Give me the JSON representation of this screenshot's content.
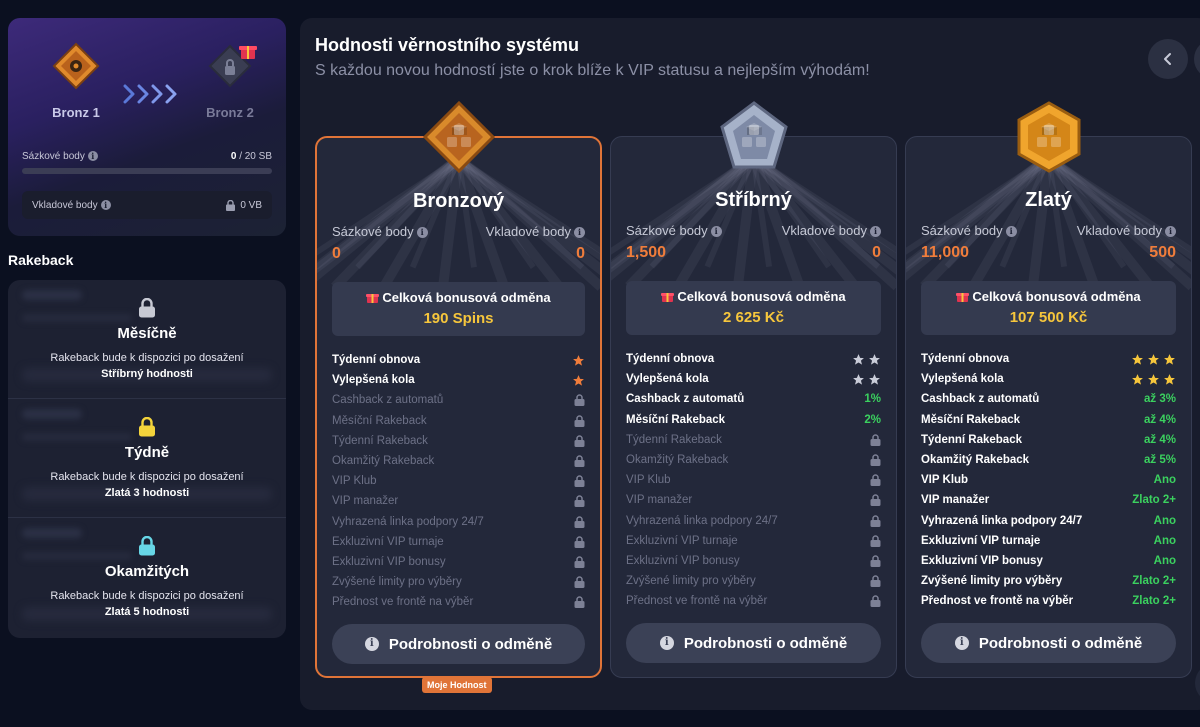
{
  "progress": {
    "from_rank": "Bronz 1",
    "to_rank": "Bronz 2",
    "betting_points_label": "Sázkové body",
    "betting_points_current": "0",
    "betting_points_target": "/ 20 SB",
    "betting_progress_fraction": 0,
    "deposit_points_label": "Vkladové body",
    "deposit_points_value": "0 VB"
  },
  "rakeback": {
    "title": "Rakeback",
    "sections": [
      {
        "name": "Měsíčně",
        "desc_pre": "Rakeback bude k dispozici po dosažení",
        "desc_bold": "Stříbrný hodnosti",
        "lock_color": "#c7c9d3"
      },
      {
        "name": "Týdně",
        "desc_pre": "Rakeback bude k dispozici po dosažení",
        "desc_bold": "Zlatá 3 hodnosti",
        "lock_color": "#f3d33b"
      },
      {
        "name": "Okamžitých",
        "desc_pre": "Rakeback bude k dispozici po dosažení",
        "desc_bold": "Zlatá 5 hodnosti",
        "lock_color": "#67d6e6"
      }
    ]
  },
  "main": {
    "title": "Hodnosti věrnostního systému",
    "subtitle": "S každou novou hodností jste o krok blíže k VIP statusu a nejlepším výhodám!",
    "back_icon": "chevron-left-icon",
    "betting_label": "Sázkové body",
    "deposit_label": "Vkladové body",
    "bonus_label": "Celková bonusová odměna",
    "details_label": "Podrobnosti o odměně",
    "current_badge": "Moje Hodnost",
    "tiers": [
      {
        "name": "Bronzový",
        "betting": "0",
        "deposit": "0",
        "bonus": "190 Spins",
        "color": "#d98a2b",
        "features": [
          {
            "label": "Týdenní obnova",
            "kind": "stars",
            "stars": 1,
            "star_color": "#f07d3b",
            "on": true
          },
          {
            "label": "Vylepšená kola",
            "kind": "stars",
            "stars": 1,
            "star_color": "#f07d3b",
            "on": true
          },
          {
            "label": "Cashback z automatů",
            "kind": "lock",
            "on": false
          },
          {
            "label": "Měsíční Rakeback",
            "kind": "lock",
            "on": false
          },
          {
            "label": "Týdenní Rakeback",
            "kind": "lock",
            "on": false
          },
          {
            "label": "Okamžitý Rakeback",
            "kind": "lock",
            "on": false
          },
          {
            "label": "VIP Klub",
            "kind": "lock",
            "on": false
          },
          {
            "label": "VIP manažer",
            "kind": "lock",
            "on": false
          },
          {
            "label": "Vyhrazená linka podpory 24/7",
            "kind": "lock",
            "on": false
          },
          {
            "label": "Exkluzivní VIP turnaje",
            "kind": "lock",
            "on": false
          },
          {
            "label": "Exkluzivní VIP bonusy",
            "kind": "lock",
            "on": false
          },
          {
            "label": "Zvýšené limity pro výběry",
            "kind": "lock",
            "on": false
          },
          {
            "label": "Přednost ve frontě na výběr",
            "kind": "lock",
            "on": false
          }
        ]
      },
      {
        "name": "Stříbrný",
        "betting": "1,500",
        "deposit": "0",
        "bonus": "2 625 Kč",
        "color": "#a6b2c9",
        "features": [
          {
            "label": "Týdenní obnova",
            "kind": "stars",
            "stars": 2,
            "star_color": "#c9ccd8",
            "on": true
          },
          {
            "label": "Vylepšená kola",
            "kind": "stars",
            "stars": 2,
            "star_color": "#c9ccd8",
            "on": true
          },
          {
            "label": "Cashback z automatů",
            "kind": "value",
            "value": "1%",
            "on": true
          },
          {
            "label": "Měsíční Rakeback",
            "kind": "value",
            "value": "2%",
            "on": true
          },
          {
            "label": "Týdenní Rakeback",
            "kind": "lock",
            "on": false
          },
          {
            "label": "Okamžitý Rakeback",
            "kind": "lock",
            "on": false
          },
          {
            "label": "VIP Klub",
            "kind": "lock",
            "on": false
          },
          {
            "label": "VIP manažer",
            "kind": "lock",
            "on": false
          },
          {
            "label": "Vyhrazená linka podpory 24/7",
            "kind": "lock",
            "on": false
          },
          {
            "label": "Exkluzivní VIP turnaje",
            "kind": "lock",
            "on": false
          },
          {
            "label": "Exkluzivní VIP bonusy",
            "kind": "lock",
            "on": false
          },
          {
            "label": "Zvýšené limity pro výběry",
            "kind": "lock",
            "on": false
          },
          {
            "label": "Přednost ve frontě na výběr",
            "kind": "lock",
            "on": false
          }
        ]
      },
      {
        "name": "Zlatý",
        "betting": "11,000",
        "deposit": "500",
        "bonus": "107 500 Kč",
        "color": "#f0a52d",
        "features": [
          {
            "label": "Týdenní obnova",
            "kind": "stars",
            "stars": 3,
            "star_color": "#f6c63c",
            "on": true
          },
          {
            "label": "Vylepšená kola",
            "kind": "stars",
            "stars": 3,
            "star_color": "#f6c63c",
            "on": true
          },
          {
            "label": "Cashback z automatů",
            "kind": "value",
            "value": "až 3%",
            "on": true
          },
          {
            "label": "Měsíční Rakeback",
            "kind": "value",
            "value": "až 4%",
            "on": true
          },
          {
            "label": "Týdenní Rakeback",
            "kind": "value",
            "value": "až 4%",
            "on": true
          },
          {
            "label": "Okamžitý Rakeback",
            "kind": "value",
            "value": "až 5%",
            "on": true
          },
          {
            "label": "VIP Klub",
            "kind": "value",
            "value": "Ano",
            "on": true
          },
          {
            "label": "VIP manažer",
            "kind": "value",
            "value": "Zlato 2+",
            "on": true
          },
          {
            "label": "Vyhrazená linka podpory 24/7",
            "kind": "value",
            "value": "Ano",
            "on": true
          },
          {
            "label": "Exkluzivní VIP turnaje",
            "kind": "value",
            "value": "Ano",
            "on": true
          },
          {
            "label": "Exkluzivní VIP bonusy",
            "kind": "value",
            "value": "Ano",
            "on": true
          },
          {
            "label": "Zvýšené limity pro výběry",
            "kind": "value",
            "value": "Zlato 2+",
            "on": true
          },
          {
            "label": "Přednost ve frontě na výběr",
            "kind": "value",
            "value": "Zlato 2+",
            "on": true
          }
        ]
      }
    ]
  }
}
